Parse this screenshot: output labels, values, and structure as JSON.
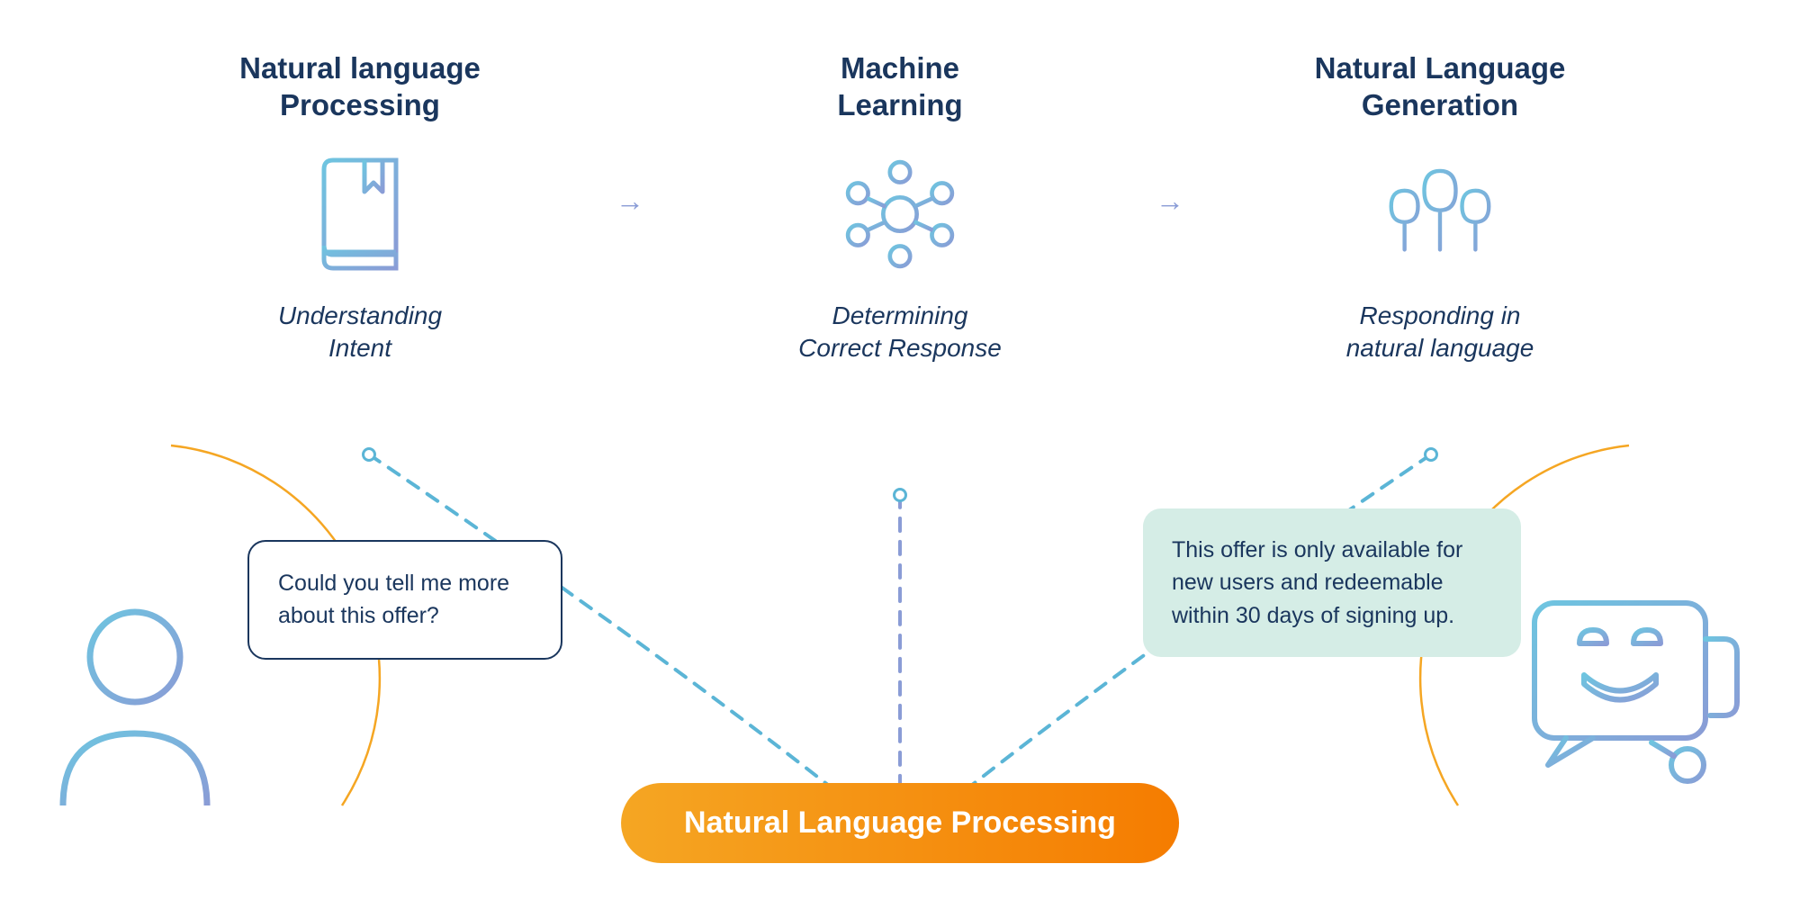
{
  "stages": [
    {
      "title": "Natural language\nProcessing",
      "subtitle": "Understanding\nIntent",
      "icon": "book-icon"
    },
    {
      "title": "Machine\nLearning",
      "subtitle": "Determining\nCorrect Response",
      "icon": "network-icon"
    },
    {
      "title": "Natural Language\nGeneration",
      "subtitle": "Responding in\nnatural language",
      "icon": "trees-icon"
    }
  ],
  "user_message": "Could you tell me more about this offer?",
  "bot_message": "This offer is only available for new users and redeemable within 30 days of signing up.",
  "pill_label": "Natural Language Processing",
  "colors": {
    "navy": "#1a365d",
    "gradient_start": "#6ec5e0",
    "gradient_end": "#8a9cd6",
    "orange_start": "#f5a623",
    "orange_end": "#f57c00",
    "mint": "#d5ede6"
  }
}
